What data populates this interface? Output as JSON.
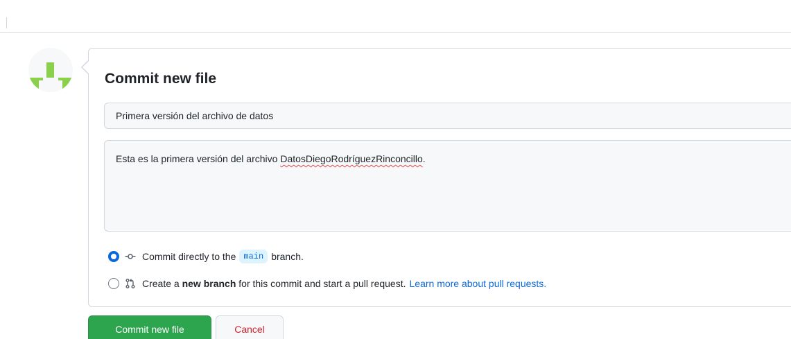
{
  "avatar": {
    "icon": "identicon-avatar",
    "color": "#8ad04a"
  },
  "commit_form": {
    "title": "Commit new file",
    "summary_value": "Primera versión del archivo de datos",
    "description": {
      "before": "Esta es la primera versión del archivo ",
      "misspelled": "DatosDiegoRodríguezRinconcillo",
      "after": "."
    },
    "options": [
      {
        "checked": true,
        "icon": "git-commit-icon",
        "text_before": "Commit directly to the",
        "branch": "main",
        "text_after": "branch."
      },
      {
        "checked": false,
        "icon": "git-pull-request-icon",
        "text_before": "Create a",
        "bold": "new branch",
        "text_after": "for this commit and start a pull request.",
        "link": "Learn more about pull requests."
      }
    ]
  },
  "buttons": {
    "commit": "Commit new file",
    "cancel": "Cancel"
  },
  "colors": {
    "accent_blue": "#0969da",
    "commit_green": "#2da44e",
    "cancel_red": "#cf222e"
  }
}
